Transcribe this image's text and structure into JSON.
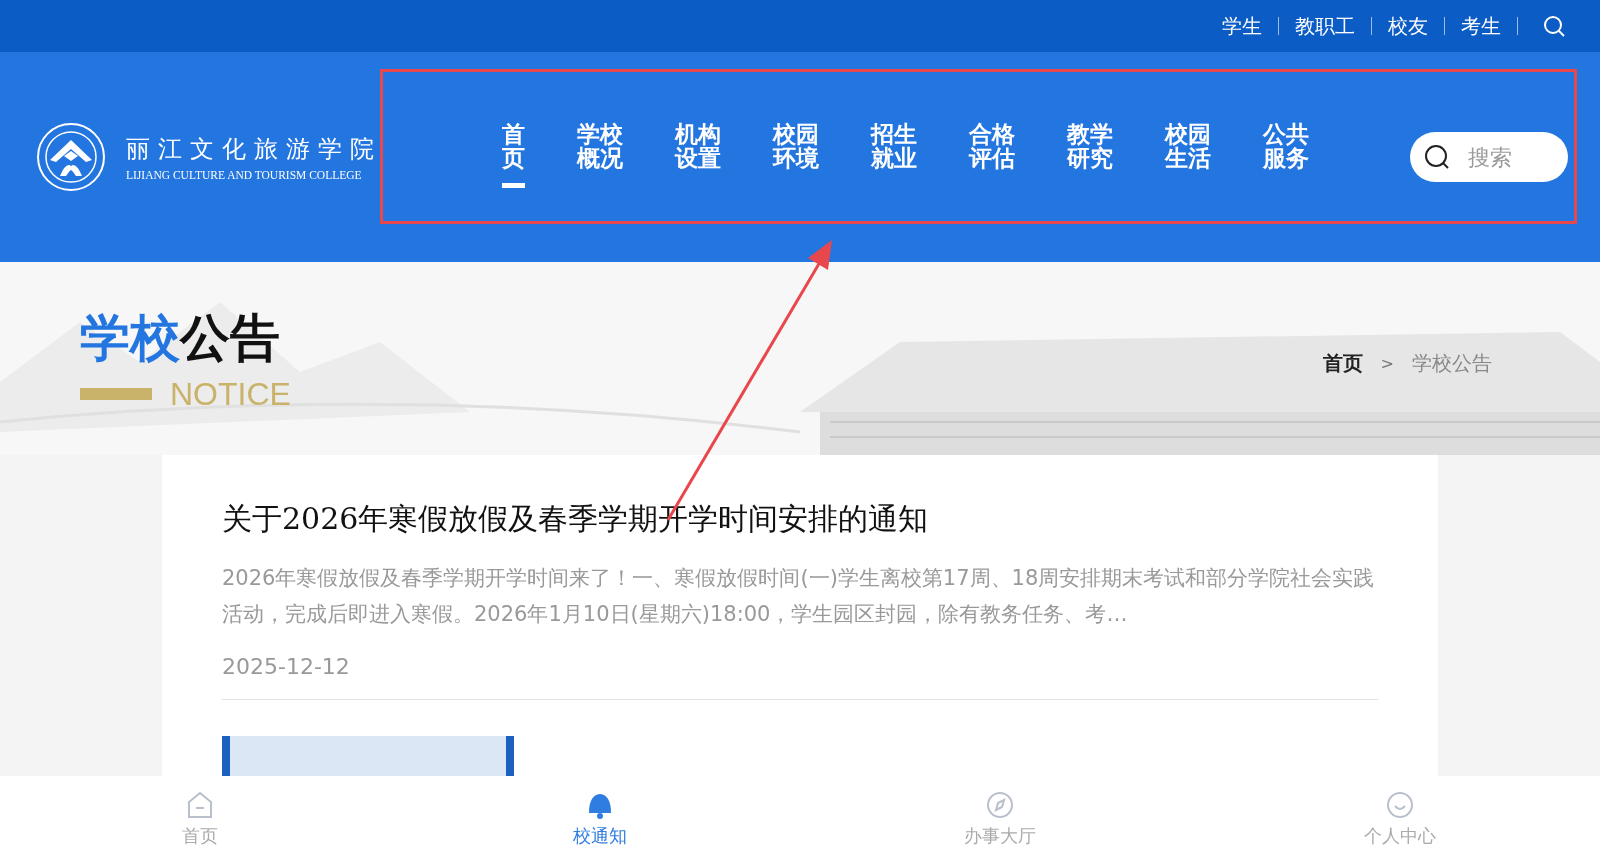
{
  "top_links": [
    "学生",
    "教职工",
    "校友",
    "考生"
  ],
  "logo": {
    "name_cn": "丽江文化旅游学院",
    "name_en": "LIJIANG CULTURE AND TOURISM COLLEGE"
  },
  "nav": [
    {
      "label": "首页",
      "selected": true
    },
    {
      "label": "学校概况",
      "selected": false
    },
    {
      "label": "机构设置",
      "selected": false
    },
    {
      "label": "校园环境",
      "selected": false
    },
    {
      "label": "招生就业",
      "selected": false
    },
    {
      "label": "合格评估",
      "selected": false
    },
    {
      "label": "教学研究",
      "selected": false
    },
    {
      "label": "校园生活",
      "selected": false
    },
    {
      "label": "公共服务",
      "selected": false
    }
  ],
  "search": {
    "placeholder": "搜索"
  },
  "page_heading": {
    "title_highlight": "学校",
    "title_rest": "公告",
    "subtitle": "NOTICE"
  },
  "breadcrumb": {
    "items": [
      "首页",
      "学校公告"
    ],
    "separator": ">"
  },
  "notices": [
    {
      "title": "关于2026年寒假放假及春季学期开学时间安排的通知",
      "summary": "2026年寒假放假及春季学期开学时间来了！一、寒假放假时间(一)学生离校第17周、18周安排期末考试和部分学院社会实践活动，完成后即进入寒假。2026年1月10日(星期六)18:00，学生园区封园，除有教务任务、考…",
      "date": "2025-12-12"
    }
  ],
  "bottom_tabs": [
    {
      "label": "首页",
      "selected": false
    },
    {
      "label": "校通知",
      "selected": true
    },
    {
      "label": "办事大厅",
      "selected": false
    },
    {
      "label": "个人中心",
      "selected": false
    }
  ]
}
